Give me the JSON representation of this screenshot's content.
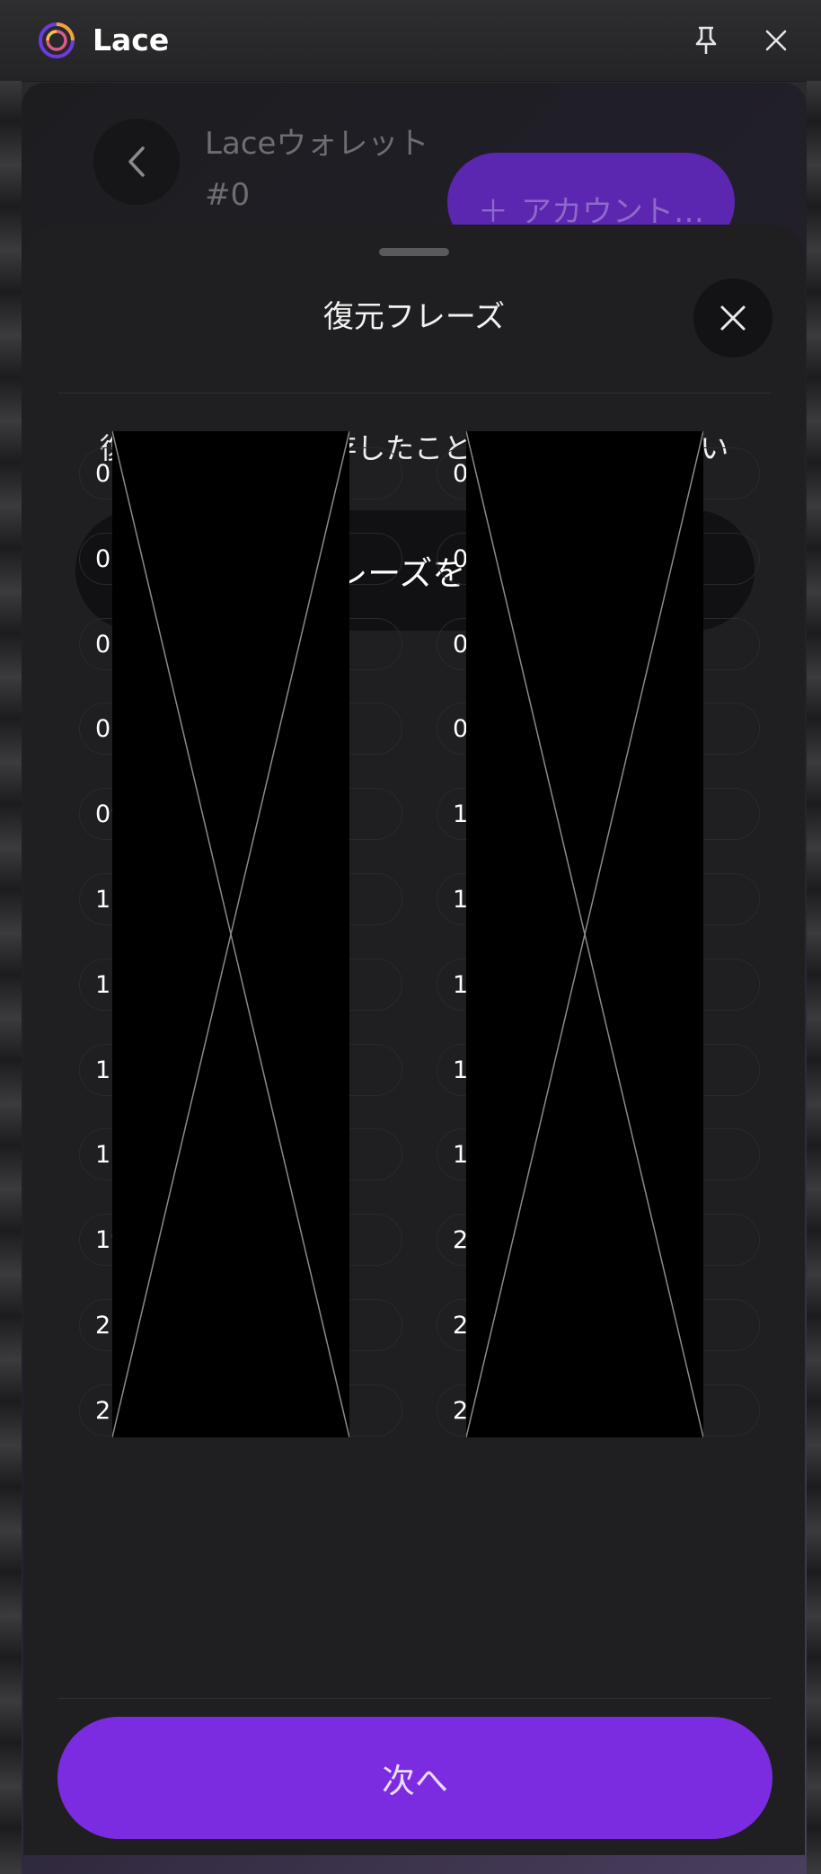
{
  "app": {
    "name": "Lace",
    "pin_icon": "pin-icon",
    "close_icon": "close-icon"
  },
  "background": {
    "wallet_name": "Laceウォレット #0",
    "add_account_label": "アカウント…"
  },
  "sheet": {
    "title": "復元フレーズ",
    "instruction": "復元フレーズを保存したことを確認してください",
    "toggle_label": "復元フレーズを非表示にする",
    "toggle_icon": "eye-closed-icon",
    "next_label": "次へ"
  },
  "recovery_words": [
    {
      "number": "01.",
      "word": ""
    },
    {
      "number": "02.",
      "word": ""
    },
    {
      "number": "03.",
      "word": ""
    },
    {
      "number": "04.",
      "word": ""
    },
    {
      "number": "05.",
      "word": ""
    },
    {
      "number": "06.",
      "word": ""
    },
    {
      "number": "07.",
      "word": ""
    },
    {
      "number": "08.",
      "word": ""
    },
    {
      "number": "09.",
      "word": ""
    },
    {
      "number": "10.",
      "word": ""
    },
    {
      "number": "11.",
      "word": ""
    },
    {
      "number": "12.",
      "word": ""
    },
    {
      "number": "13.",
      "word": ""
    },
    {
      "number": "14.",
      "word": ""
    },
    {
      "number": "15.",
      "word": ""
    },
    {
      "number": "16.",
      "word": ""
    },
    {
      "number": "17.",
      "word": ""
    },
    {
      "number": "18.",
      "word": ""
    },
    {
      "number": "19.",
      "word": ""
    },
    {
      "number": "20.",
      "word": ""
    },
    {
      "number": "21.",
      "word": ""
    },
    {
      "number": "22.",
      "word": ""
    },
    {
      "number": "23.",
      "word": ""
    },
    {
      "number": "24.",
      "word": ""
    }
  ],
  "colors": {
    "accent": "#7b2ce0",
    "sheet_background": "#1f1f21",
    "button_dark": "#111113"
  }
}
